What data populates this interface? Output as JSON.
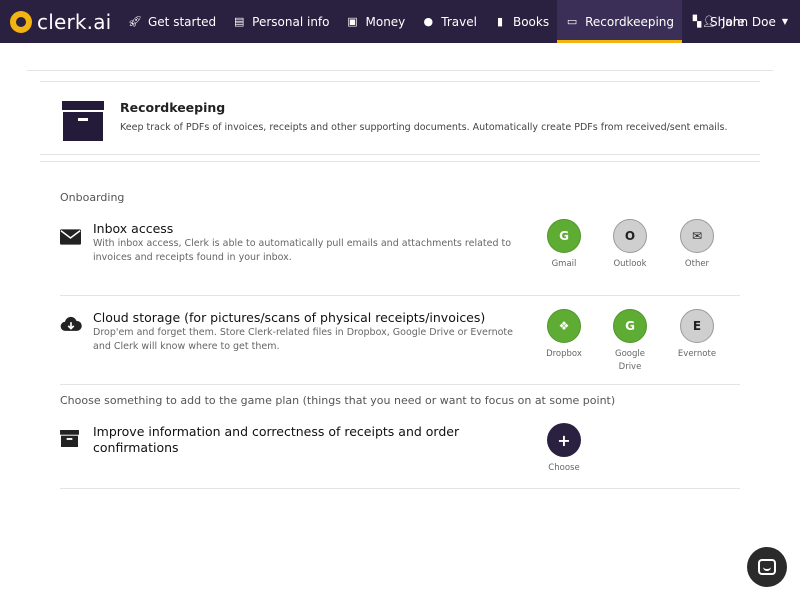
{
  "brand": {
    "name": "clerk.ai"
  },
  "nav": {
    "items": [
      {
        "label": "Get started",
        "icon": "rocket-icon"
      },
      {
        "label": "Personal info",
        "icon": "id-card-icon"
      },
      {
        "label": "Money",
        "icon": "money-icon"
      },
      {
        "label": "Travel",
        "icon": "globe-icon"
      },
      {
        "label": "Books",
        "icon": "book-icon"
      },
      {
        "label": "Recordkeeping",
        "icon": "archive-icon",
        "active": true
      },
      {
        "label": "Share",
        "icon": "share-icon"
      }
    ],
    "user": {
      "name": "John Doe",
      "icon": "user-icon"
    }
  },
  "header": {
    "title": "Recordkeeping",
    "description": "Keep track of PDFs of invoices, receipts and other supporting documents. Automatically create PDFs from received/sent emails."
  },
  "onboarding": {
    "label": "Onboarding",
    "rows": [
      {
        "title": "Inbox access",
        "description": "With inbox access, Clerk is able to automatically pull emails and attachments related to invoices and receipts found in your inbox.",
        "icon": "envelope-icon",
        "options": [
          {
            "glyph": "G",
            "label": "Gmail",
            "style": "green"
          },
          {
            "glyph": "O",
            "label": "Outlook",
            "style": "gray"
          },
          {
            "glyph": "✉",
            "label": "Other",
            "style": "gray"
          }
        ]
      },
      {
        "title": "Cloud storage (for pictures/scans of physical receipts/invoices)",
        "description": "Drop'em and forget them. Store Clerk-related files in Dropbox, Google Drive or Evernote and Clerk will know where to get them.",
        "icon": "cloud-download-icon",
        "options": [
          {
            "glyph": "❖",
            "label": "Dropbox",
            "style": "green"
          },
          {
            "glyph": "G",
            "label": "Google Drive",
            "style": "green"
          },
          {
            "glyph": "E",
            "label": "Evernote",
            "style": "gray"
          }
        ]
      }
    ]
  },
  "gameplan": {
    "label": "Choose something to add to the game plan (things that you need or want to focus on at some point)",
    "rows": [
      {
        "title": "Improve information and correctness of receipts and order confirmations",
        "icon": "archive-icon",
        "option": {
          "glyph": "+",
          "label": "Choose"
        }
      }
    ]
  },
  "chat": {
    "icon": "chat-icon"
  },
  "colors": {
    "navbar": "#2a2040",
    "accent": "#f3b311",
    "green": "#5fac35",
    "gray": "#cfcfcf"
  }
}
